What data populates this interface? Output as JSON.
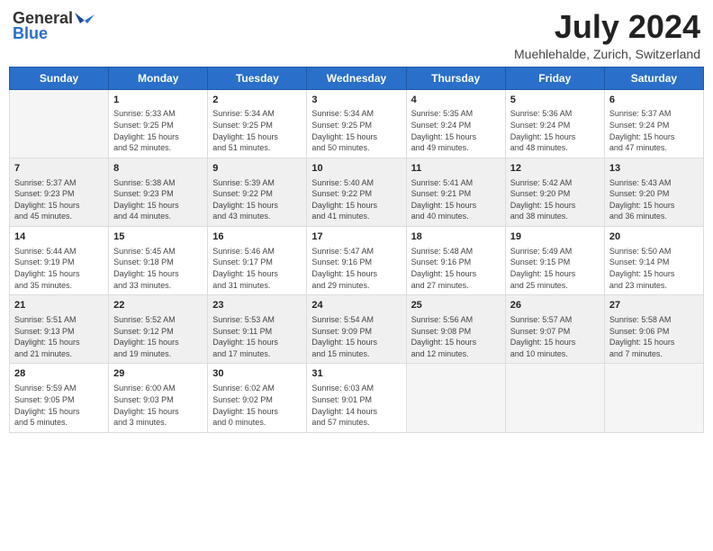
{
  "header": {
    "logo_general": "General",
    "logo_blue": "Blue",
    "month_year": "July 2024",
    "location": "Muehlehalde, Zurich, Switzerland"
  },
  "days_of_week": [
    "Sunday",
    "Monday",
    "Tuesday",
    "Wednesday",
    "Thursday",
    "Friday",
    "Saturday"
  ],
  "weeks": [
    [
      {
        "day": "",
        "info": ""
      },
      {
        "day": "1",
        "info": "Sunrise: 5:33 AM\nSunset: 9:25 PM\nDaylight: 15 hours\nand 52 minutes."
      },
      {
        "day": "2",
        "info": "Sunrise: 5:34 AM\nSunset: 9:25 PM\nDaylight: 15 hours\nand 51 minutes."
      },
      {
        "day": "3",
        "info": "Sunrise: 5:34 AM\nSunset: 9:25 PM\nDaylight: 15 hours\nand 50 minutes."
      },
      {
        "day": "4",
        "info": "Sunrise: 5:35 AM\nSunset: 9:24 PM\nDaylight: 15 hours\nand 49 minutes."
      },
      {
        "day": "5",
        "info": "Sunrise: 5:36 AM\nSunset: 9:24 PM\nDaylight: 15 hours\nand 48 minutes."
      },
      {
        "day": "6",
        "info": "Sunrise: 5:37 AM\nSunset: 9:24 PM\nDaylight: 15 hours\nand 47 minutes."
      }
    ],
    [
      {
        "day": "7",
        "info": "Sunrise: 5:37 AM\nSunset: 9:23 PM\nDaylight: 15 hours\nand 45 minutes."
      },
      {
        "day": "8",
        "info": "Sunrise: 5:38 AM\nSunset: 9:23 PM\nDaylight: 15 hours\nand 44 minutes."
      },
      {
        "day": "9",
        "info": "Sunrise: 5:39 AM\nSunset: 9:22 PM\nDaylight: 15 hours\nand 43 minutes."
      },
      {
        "day": "10",
        "info": "Sunrise: 5:40 AM\nSunset: 9:22 PM\nDaylight: 15 hours\nand 41 minutes."
      },
      {
        "day": "11",
        "info": "Sunrise: 5:41 AM\nSunset: 9:21 PM\nDaylight: 15 hours\nand 40 minutes."
      },
      {
        "day": "12",
        "info": "Sunrise: 5:42 AM\nSunset: 9:20 PM\nDaylight: 15 hours\nand 38 minutes."
      },
      {
        "day": "13",
        "info": "Sunrise: 5:43 AM\nSunset: 9:20 PM\nDaylight: 15 hours\nand 36 minutes."
      }
    ],
    [
      {
        "day": "14",
        "info": "Sunrise: 5:44 AM\nSunset: 9:19 PM\nDaylight: 15 hours\nand 35 minutes."
      },
      {
        "day": "15",
        "info": "Sunrise: 5:45 AM\nSunset: 9:18 PM\nDaylight: 15 hours\nand 33 minutes."
      },
      {
        "day": "16",
        "info": "Sunrise: 5:46 AM\nSunset: 9:17 PM\nDaylight: 15 hours\nand 31 minutes."
      },
      {
        "day": "17",
        "info": "Sunrise: 5:47 AM\nSunset: 9:16 PM\nDaylight: 15 hours\nand 29 minutes."
      },
      {
        "day": "18",
        "info": "Sunrise: 5:48 AM\nSunset: 9:16 PM\nDaylight: 15 hours\nand 27 minutes."
      },
      {
        "day": "19",
        "info": "Sunrise: 5:49 AM\nSunset: 9:15 PM\nDaylight: 15 hours\nand 25 minutes."
      },
      {
        "day": "20",
        "info": "Sunrise: 5:50 AM\nSunset: 9:14 PM\nDaylight: 15 hours\nand 23 minutes."
      }
    ],
    [
      {
        "day": "21",
        "info": "Sunrise: 5:51 AM\nSunset: 9:13 PM\nDaylight: 15 hours\nand 21 minutes."
      },
      {
        "day": "22",
        "info": "Sunrise: 5:52 AM\nSunset: 9:12 PM\nDaylight: 15 hours\nand 19 minutes."
      },
      {
        "day": "23",
        "info": "Sunrise: 5:53 AM\nSunset: 9:11 PM\nDaylight: 15 hours\nand 17 minutes."
      },
      {
        "day": "24",
        "info": "Sunrise: 5:54 AM\nSunset: 9:09 PM\nDaylight: 15 hours\nand 15 minutes."
      },
      {
        "day": "25",
        "info": "Sunrise: 5:56 AM\nSunset: 9:08 PM\nDaylight: 15 hours\nand 12 minutes."
      },
      {
        "day": "26",
        "info": "Sunrise: 5:57 AM\nSunset: 9:07 PM\nDaylight: 15 hours\nand 10 minutes."
      },
      {
        "day": "27",
        "info": "Sunrise: 5:58 AM\nSunset: 9:06 PM\nDaylight: 15 hours\nand 7 minutes."
      }
    ],
    [
      {
        "day": "28",
        "info": "Sunrise: 5:59 AM\nSunset: 9:05 PM\nDaylight: 15 hours\nand 5 minutes."
      },
      {
        "day": "29",
        "info": "Sunrise: 6:00 AM\nSunset: 9:03 PM\nDaylight: 15 hours\nand 3 minutes."
      },
      {
        "day": "30",
        "info": "Sunrise: 6:02 AM\nSunset: 9:02 PM\nDaylight: 15 hours\nand 0 minutes."
      },
      {
        "day": "31",
        "info": "Sunrise: 6:03 AM\nSunset: 9:01 PM\nDaylight: 14 hours\nand 57 minutes."
      },
      {
        "day": "",
        "info": ""
      },
      {
        "day": "",
        "info": ""
      },
      {
        "day": "",
        "info": ""
      }
    ]
  ]
}
